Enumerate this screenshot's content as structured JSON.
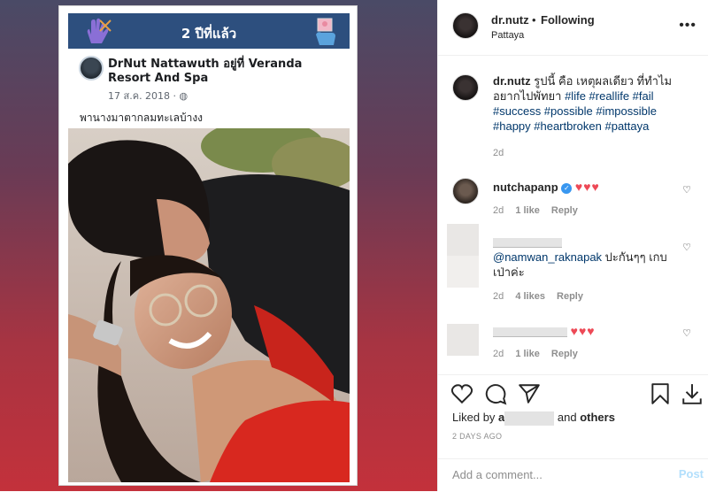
{
  "facebook_card": {
    "header_title": "2 ปีที่แล้ว",
    "name": "DrNut Nattawuth อยู่ที่ Veranda Resort And Spa",
    "date": "17 ส.ค. 2018 · ",
    "globe_icon": "globe-icon",
    "caption": "พานางมาตากลมทะเลบ้างง"
  },
  "header": {
    "username": "dr.nutz",
    "dot": "•",
    "following": "Following",
    "location": "Pattaya"
  },
  "comments": {
    "caption": {
      "user": "dr.nutz",
      "text": "รูปนี้ คือ เหตุผลเดียว ที่ทำไม อยากไปพัทยา",
      "tags": "#life #reallife #fail #success #possible #impossible #happy #heartbroken #pattaya",
      "time": "2d"
    },
    "c1": {
      "user": "nutchapanp",
      "hearts": "♥♥♥",
      "time": "2d",
      "likes": "1 like",
      "reply": "Reply"
    },
    "c2": {
      "mention": "@namwan_raknapak",
      "text": " ปะกันๆๆ เกบเป่าค่ะ",
      "time": "2d",
      "likes": "4 likes",
      "reply": "Reply"
    },
    "c3": {
      "hearts": "♥♥♥",
      "time": "2d",
      "likes": "1 like",
      "reply": "Reply"
    }
  },
  "actions": {
    "liked_prefix": "Liked by ",
    "liked_first": "a",
    "liked_and": " and ",
    "liked_others": "others",
    "time_ago": "2 DAYS AGO",
    "comment_placeholder": "Add a comment...",
    "post": "Post"
  },
  "colors": {
    "accent": "#0095f6",
    "heart": "#ed4956",
    "tag": "#00376b",
    "verified": "#3897f0"
  }
}
